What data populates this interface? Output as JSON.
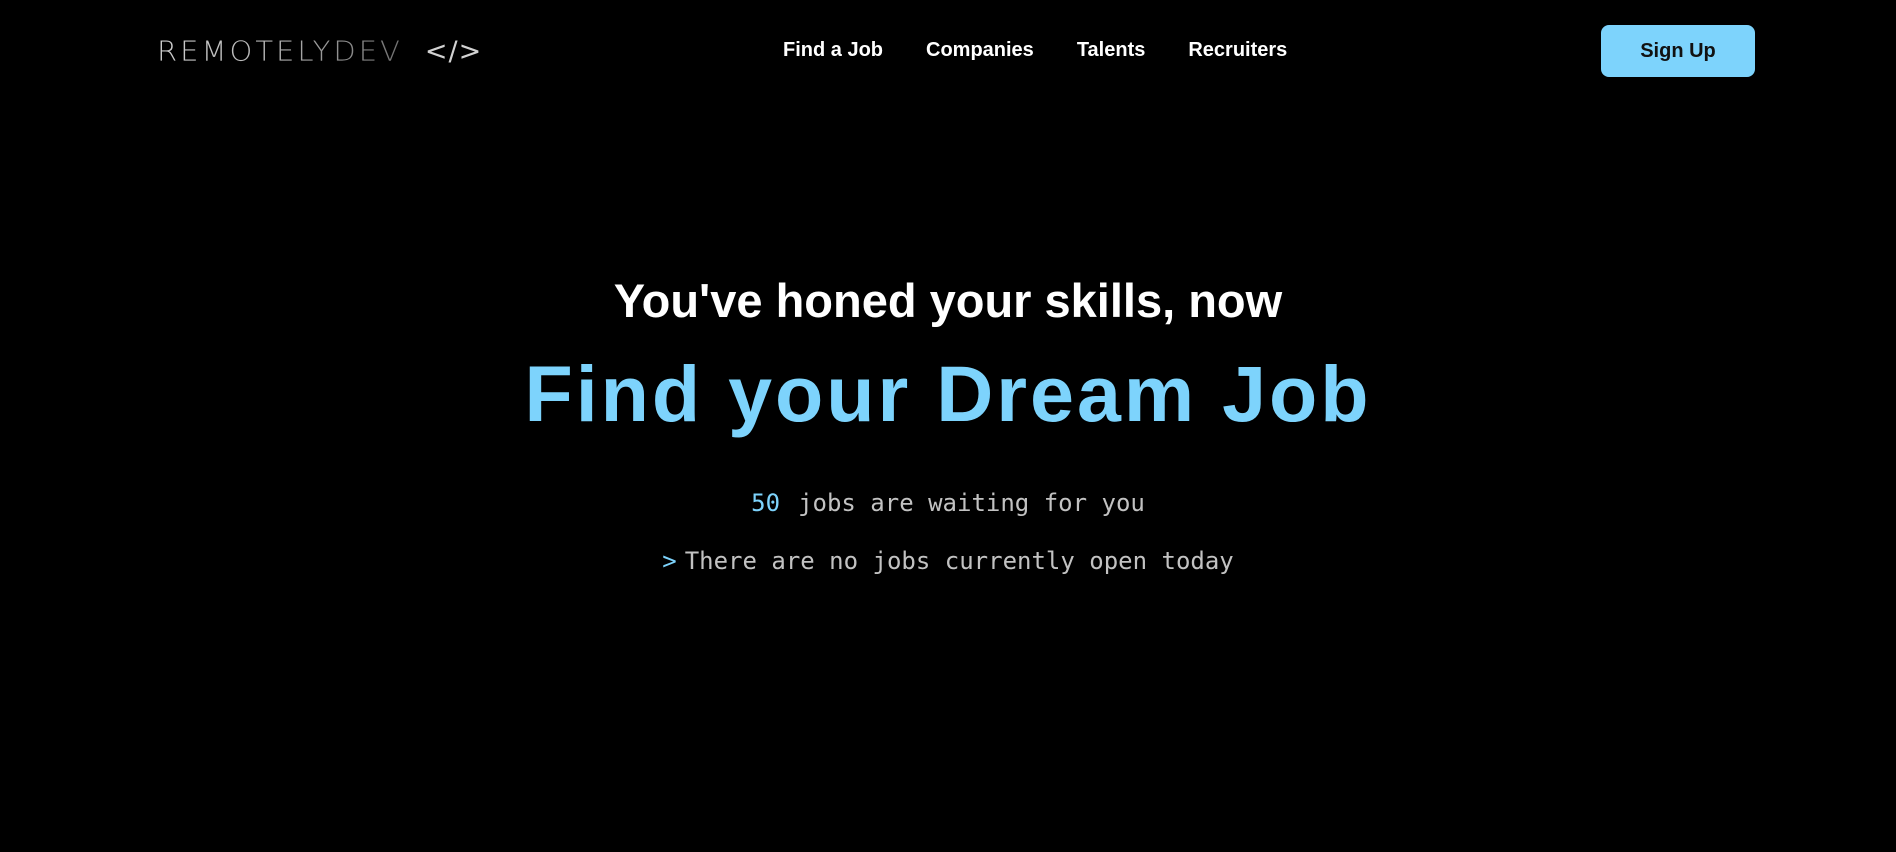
{
  "header": {
    "logo": {
      "wordmark": "REMOTELYDEV",
      "code_symbol": "</>"
    },
    "nav": [
      {
        "label": "Find a Job"
      },
      {
        "label": "Companies"
      },
      {
        "label": "Talents"
      },
      {
        "label": "Recruiters"
      }
    ],
    "signup_label": "Sign Up"
  },
  "hero": {
    "tagline": "You've honed your skills, now",
    "headline": "Find your Dream Job",
    "jobs_count": "50",
    "jobs_text": "jobs are waiting for you",
    "prompt_symbol": ">",
    "status_text": "There are no jobs currently open today"
  },
  "colors": {
    "background": "#000000",
    "accent": "#7dd3fc",
    "text": "#ffffff",
    "muted_text": "#c2c2c2"
  },
  "icons": {
    "logo": "code-brackets-icon",
    "prompt": "chevron-right-icon"
  }
}
